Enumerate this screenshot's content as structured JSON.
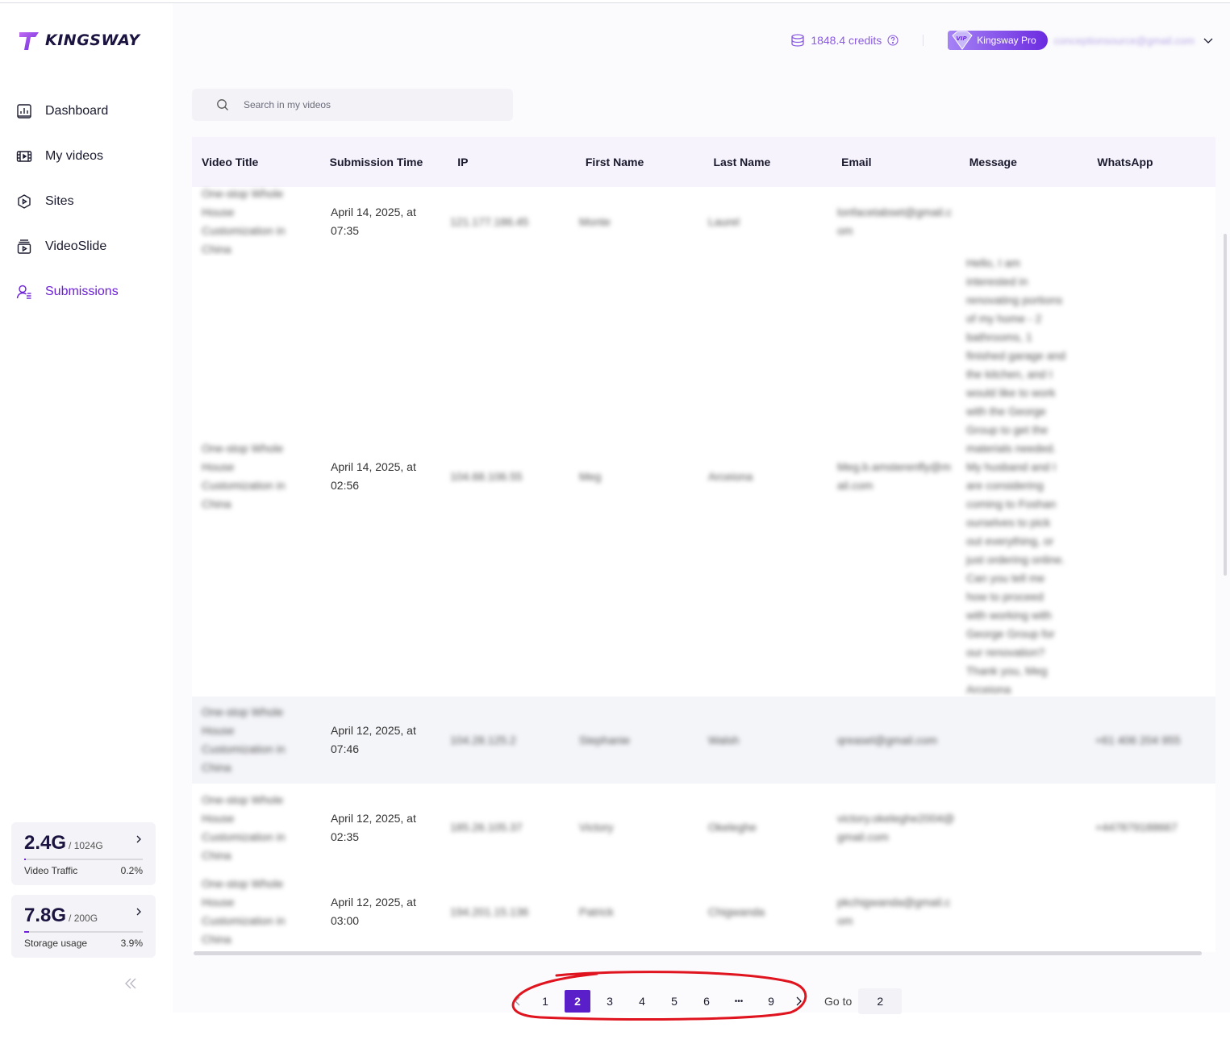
{
  "brand": {
    "name": "KINGSWAY"
  },
  "nav": {
    "items": [
      {
        "label": "Dashboard",
        "icon": "dashboard-icon"
      },
      {
        "label": "My videos",
        "icon": "film-icon"
      },
      {
        "label": "Sites",
        "icon": "sites-icon"
      },
      {
        "label": "VideoSlide",
        "icon": "videoslide-icon"
      },
      {
        "label": "Submissions",
        "icon": "user-list-icon",
        "active": true
      }
    ]
  },
  "usage": {
    "traffic": {
      "used": "2.4G",
      "total": "/ 1024G",
      "label": "Video Traffic",
      "percent": "0.2%",
      "fraction": 0.002
    },
    "storage": {
      "used": "7.8G",
      "total": "/ 200G",
      "label": "Storage usage",
      "percent": "3.9%",
      "fraction": 0.039
    }
  },
  "header": {
    "credits": "1848.4 credits",
    "plan": "Kingsway Pro",
    "email": "conceptionsource@gmail.com"
  },
  "search": {
    "placeholder": "Search in my videos"
  },
  "table": {
    "columns": [
      "Video Title",
      "Submission Time",
      "IP",
      "First Name",
      "Last Name",
      "Email",
      "Message",
      "WhatsApp"
    ],
    "rows": [
      {
        "title": "One-stop Whole House Customization in China",
        "time": "April 14, 2025, at 07:35",
        "ip": "121.177.186.45",
        "first": "Monte",
        "last": "Laurel",
        "email": "lonfacetabset@gmail.com",
        "message": "",
        "whatsapp": ""
      },
      {
        "title": "One-stop Whole House Customization in China",
        "time": "April 14, 2025, at 02:56",
        "ip": "104.68.106.55",
        "first": "Meg",
        "last": "Arceiona",
        "email": "Meg.b.amsterenfly@mail.com",
        "message": "Hello, I am interested in renovating portions of my home - 2 bathrooms, 1 finished garage and the kitchen, and I would like to work with the George Group to get the materials needed. My husband and I are considering coming to Foshan ourselves to pick out everything, or just ordering online. Can you tell me how to proceed with working with George Group for our renovation? Thank you, Meg Arceiona",
        "whatsapp": ""
      },
      {
        "title": "One-stop Whole House Customization in China",
        "time": "April 12, 2025, at 07:46",
        "ip": "104.28.125.2",
        "first": "Stephanie",
        "last": "Walsh",
        "email": "qreasel@gmail.com",
        "message": "",
        "whatsapp": "+61 406 204 955"
      },
      {
        "title": "One-stop Whole House Customization in China",
        "time": "April 12, 2025, at 02:35",
        "ip": "185.26.105.37",
        "first": "Victory",
        "last": "Okeleghe",
        "email": "victory.okeleghe2004@gmail.com",
        "message": "",
        "whatsapp": "+447879188667"
      },
      {
        "title": "One-stop Whole House Customization in China",
        "time": "April 12, 2025, at 03:00",
        "ip": "194.201.15.136",
        "first": "Patrick",
        "last": "Chigwanda",
        "email": "pkchigwanda@gmail.com",
        "message": "",
        "whatsapp": ""
      }
    ]
  },
  "pagination": {
    "pages": [
      "1",
      "2",
      "3",
      "4",
      "5",
      "6",
      "•••",
      "9"
    ],
    "current": "2",
    "goto_label": "Go to",
    "goto_value": "2"
  },
  "colors": {
    "accent": "#5a1fc9",
    "annotation": "#e0141e"
  }
}
